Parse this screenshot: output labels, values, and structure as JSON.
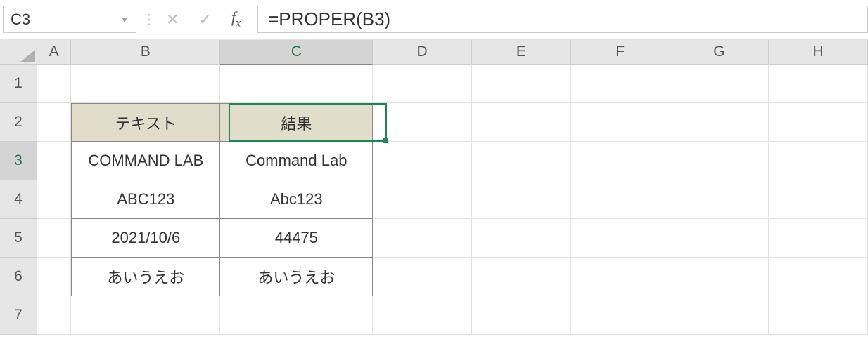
{
  "name_box": {
    "value": "C3"
  },
  "formula": {
    "value": "=PROPER(B3)"
  },
  "columns": [
    {
      "id": "A",
      "cls": "cA"
    },
    {
      "id": "B",
      "cls": "cB"
    },
    {
      "id": "C",
      "cls": "cC",
      "active": true
    },
    {
      "id": "D",
      "cls": "cD"
    },
    {
      "id": "E",
      "cls": "cE"
    },
    {
      "id": "F",
      "cls": "cF"
    },
    {
      "id": "G",
      "cls": "cG"
    },
    {
      "id": "H",
      "cls": "cH"
    }
  ],
  "rows": [
    "1",
    "2",
    "3",
    "4",
    "5",
    "6",
    "7"
  ],
  "active_row": "3",
  "table": {
    "headers": {
      "B": "テキスト",
      "C": "結果"
    },
    "rows": [
      {
        "B": "COMMAND LAB",
        "C": "Command Lab"
      },
      {
        "B": "ABC123",
        "C": "Abc123"
      },
      {
        "B": "2021/10/6",
        "C": "44475"
      },
      {
        "B": "あいうえお",
        "C": "あいうえお"
      }
    ]
  },
  "icons": {
    "cancel": "✕",
    "enter": "✓"
  },
  "selected_cell": "C3"
}
